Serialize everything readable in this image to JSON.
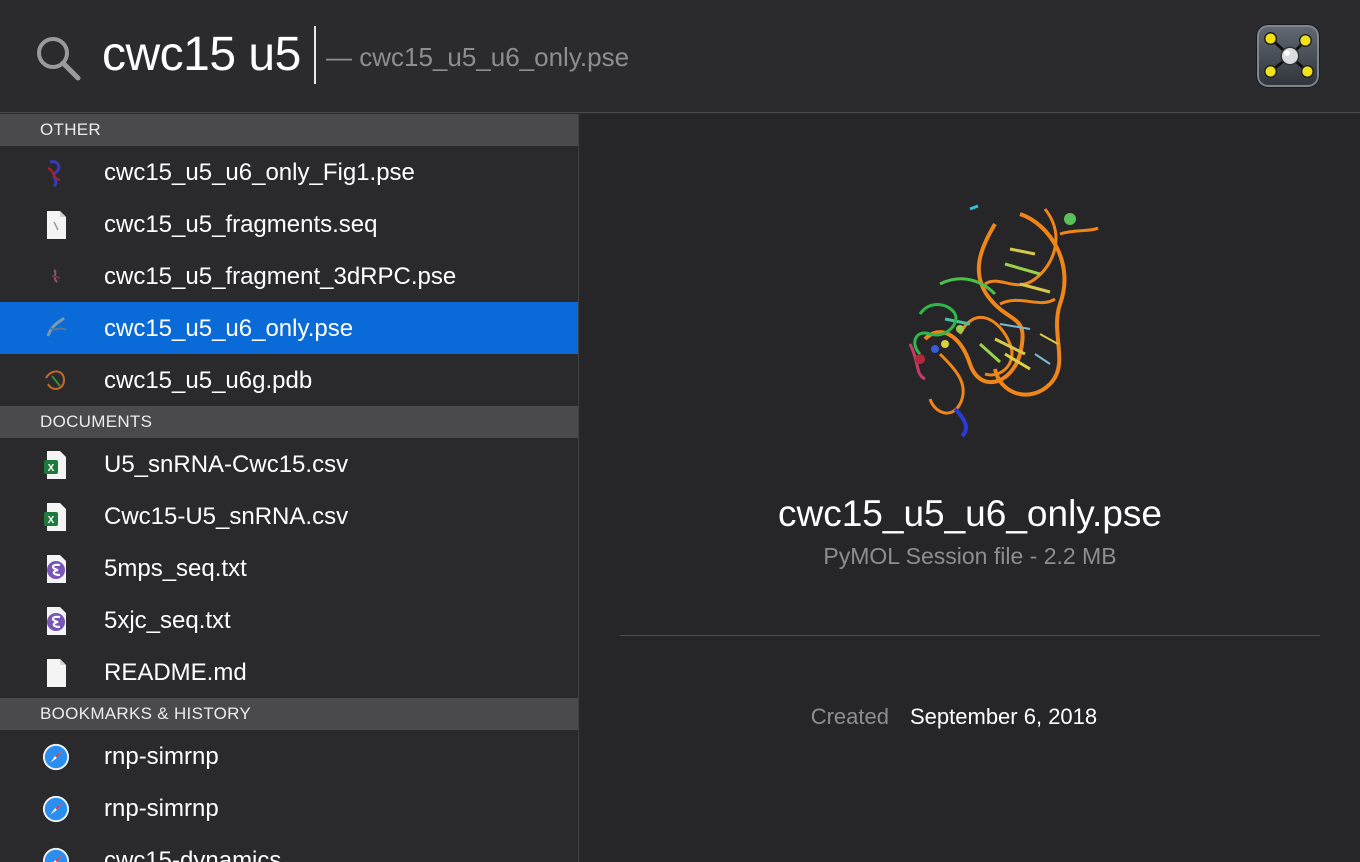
{
  "search": {
    "query": "cwc15 u5",
    "completion": "— cwc15_u5_u6_only.pse",
    "app_icon": "pymol-app-icon"
  },
  "sections": [
    {
      "header": "OTHER",
      "items": [
        {
          "label": "cwc15_u5_u6_only_Fig1.pse",
          "icon": "molecule-thumbnail-icon",
          "selected": false
        },
        {
          "label": "cwc15_u5_fragments.seq",
          "icon": "text-document-icon",
          "selected": false
        },
        {
          "label": "cwc15_u5_fragment_3dRPC.pse",
          "icon": "molecule-thumbnail-icon",
          "selected": false
        },
        {
          "label": "cwc15_u5_u6_only.pse",
          "icon": "molecule-thumbnail-icon",
          "selected": true
        },
        {
          "label": "cwc15_u5_u6g.pdb",
          "icon": "molecule-thumbnail-icon",
          "selected": false
        }
      ]
    },
    {
      "header": "DOCUMENTS",
      "items": [
        {
          "label": "U5_snRNA-Cwc15.csv",
          "icon": "excel-csv-icon",
          "selected": false
        },
        {
          "label": "Cwc15-U5_snRNA.csv",
          "icon": "excel-csv-icon",
          "selected": false
        },
        {
          "label": "5mps_seq.txt",
          "icon": "emacs-text-icon",
          "selected": false
        },
        {
          "label": "5xjc_seq.txt",
          "icon": "emacs-text-icon",
          "selected": false
        },
        {
          "label": "README.md",
          "icon": "blank-document-icon",
          "selected": false
        }
      ]
    },
    {
      "header": "BOOKMARKS & HISTORY",
      "items": [
        {
          "label": "rnp-simrnp",
          "icon": "safari-compass-icon",
          "selected": false
        },
        {
          "label": "rnp-simrnp",
          "icon": "safari-compass-icon",
          "selected": false
        },
        {
          "label": "cwc15-dynamics",
          "icon": "safari-compass-icon",
          "selected": false
        }
      ]
    }
  ],
  "preview": {
    "title": "cwc15_u5_u6_only.pse",
    "subtitle": "PyMOL Session file - 2.2 MB",
    "thumbnail": "rna-structure-preview",
    "meta": {
      "key": "Created",
      "value": "September 6, 2018"
    }
  },
  "colors": {
    "selection": "#0a6bd8",
    "section_header": "#4a4a4c",
    "background": "#2a2a2c",
    "rna_backbone": "#f0861a"
  }
}
